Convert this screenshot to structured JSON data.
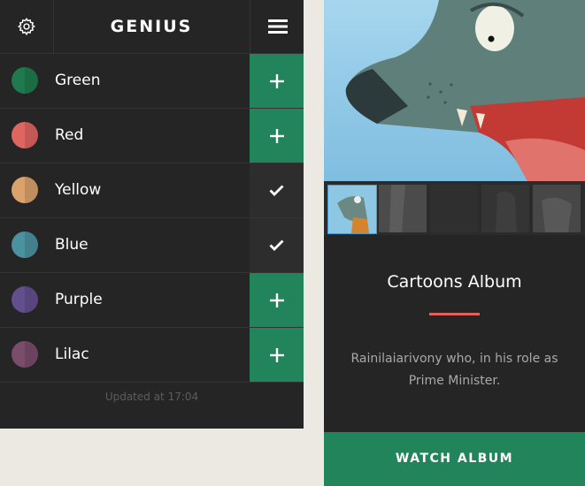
{
  "app": {
    "title": "GENIUS"
  },
  "colors": {
    "accent_green": "#21845a",
    "accent_red": "#e0625b",
    "panel": "#252525",
    "background": "#ece8e2"
  },
  "list": {
    "items": [
      {
        "label": "Green",
        "color": "#1f7a4f",
        "state": "add"
      },
      {
        "label": "Red",
        "color": "#e06560",
        "state": "add"
      },
      {
        "label": "Yellow",
        "color": "#dba26b",
        "state": "checked"
      },
      {
        "label": "Blue",
        "color": "#4a92a0",
        "state": "checked"
      },
      {
        "label": "Purple",
        "color": "#634f8e",
        "state": "add"
      },
      {
        "label": "Lilac",
        "color": "#7a4d6c",
        "state": "add"
      }
    ],
    "updated": "Updated at 17:04"
  },
  "icons": {
    "settings": "gear-icon",
    "menu": "hamburger-menu-icon",
    "add": "plus-icon",
    "checked": "checkmark-icon"
  },
  "album": {
    "title": "Cartoons Album",
    "description": "Rainilaiarivony who, in his role as Prime Minister.",
    "button": "WATCH ALBUM"
  }
}
